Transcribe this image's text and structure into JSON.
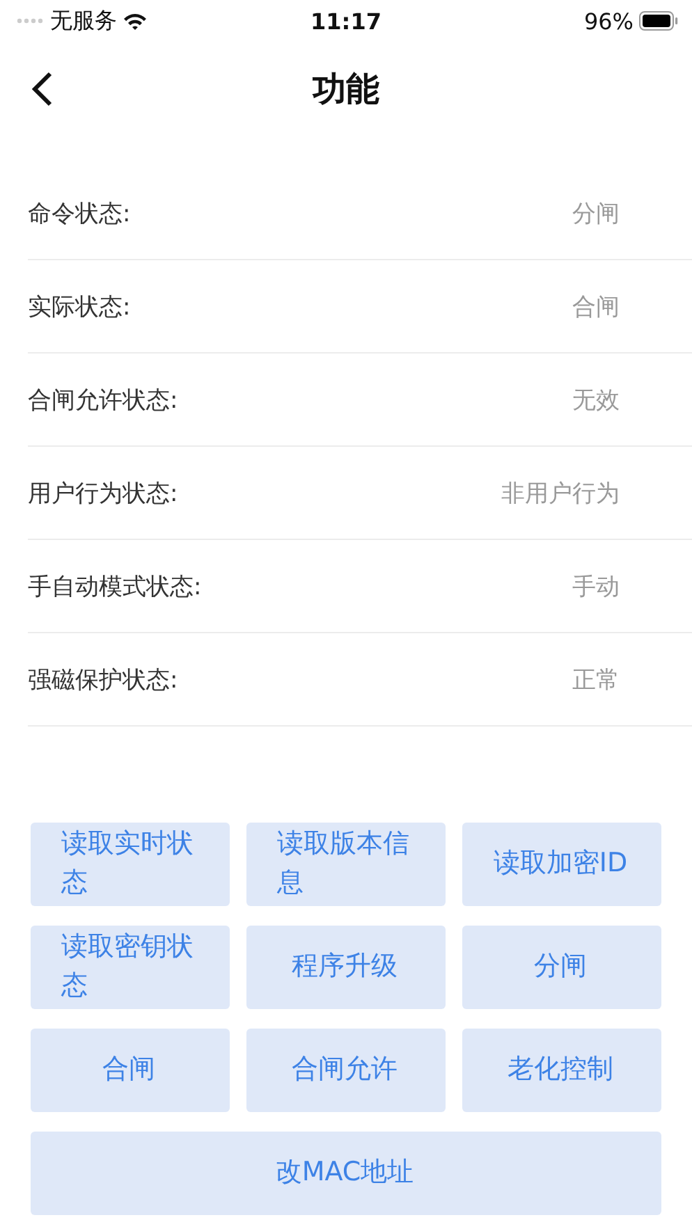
{
  "status_bar": {
    "carrier": "无服务",
    "time": "11:17",
    "battery": "96%"
  },
  "nav": {
    "title": "功能"
  },
  "rows": [
    {
      "label": "命令状态:",
      "value": "分闸"
    },
    {
      "label": "实际状态:",
      "value": "合闸"
    },
    {
      "label": "合闸允许状态:",
      "value": "无效"
    },
    {
      "label": "用户行为状态:",
      "value": "非用户行为"
    },
    {
      "label": "手自动模式状态:",
      "value": "手动"
    },
    {
      "label": "强磁保护状态:",
      "value": "正常"
    }
  ],
  "buttons": [
    "读取实时状态",
    "读取版本信息",
    "读取加密ID",
    "读取密钥状态",
    "程序升级",
    "分闸",
    "合闸",
    "合闸允许",
    "老化控制"
  ],
  "wide_button": "改MAC地址"
}
